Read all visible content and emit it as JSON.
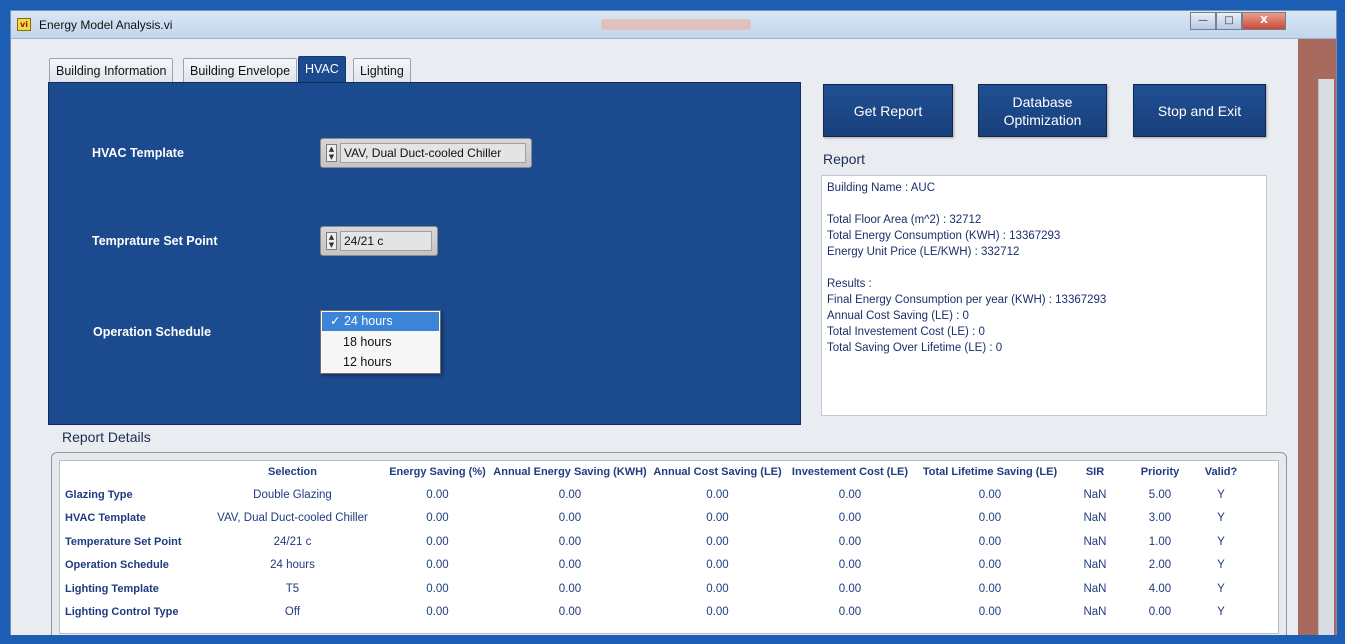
{
  "window": {
    "title": "Energy Model Analysis.vi",
    "app_icon_text": "vi",
    "minimize_glyph": "—",
    "maximize_glyph": "□",
    "close_glyph": "X"
  },
  "tabs": [
    {
      "label": "Building Information"
    },
    {
      "label": "Building Envelope"
    },
    {
      "label": "HVAC"
    },
    {
      "label": "Lighting"
    }
  ],
  "hvac": {
    "template_label": "HVAC Template",
    "template_value": "VAV, Dual Duct-cooled Chiller",
    "setpoint_label": "Temprature Set Point",
    "setpoint_value": "24/21 c",
    "schedule_label": "Operation Schedule",
    "schedule_options": [
      "✓ 24 hours",
      "18 hours",
      "12 hours"
    ]
  },
  "buttons": {
    "get_report": "Get Report",
    "database_optimization_line1": "Database",
    "database_optimization_line2": "Optimization",
    "stop_exit": "Stop and Exit"
  },
  "report": {
    "label": "Report",
    "lines": [
      "Building Name : AUC",
      "",
      "Total Floor Area  (m^2) : 32712",
      "Total Energy Consumption  (KWH) : 13367293",
      "Energy Unit Price  (LE/KWH) : 332712",
      "",
      "Results :",
      "Final Energy Consumption per year  (KWH) :  13367293",
      "Annual Cost Saving (LE) : 0",
      "Total Investement Cost  (LE) : 0",
      "Total Saving Over Lifetime (LE) : 0"
    ]
  },
  "details": {
    "label": "Report Details",
    "headers": [
      "",
      "Selection",
      "Energy Saving (%)",
      "Annual Energy Saving (KWH)",
      "Annual Cost Saving (LE)",
      "Investement Cost (LE)",
      "Total Lifetime Saving (LE)",
      "SIR",
      "Priority",
      "Valid?"
    ],
    "rows": [
      [
        "Glazing Type",
        "Double Glazing",
        "0.00",
        "0.00",
        "0.00",
        "0.00",
        "0.00",
        "NaN",
        "5.00",
        "Y"
      ],
      [
        "HVAC Template",
        "VAV, Dual Duct-cooled Chiller",
        "0.00",
        "0.00",
        "0.00",
        "0.00",
        "0.00",
        "NaN",
        "3.00",
        "Y"
      ],
      [
        "Temperature Set Point",
        "24/21 c",
        "0.00",
        "0.00",
        "0.00",
        "0.00",
        "0.00",
        "NaN",
        "1.00",
        "Y"
      ],
      [
        "Operation Schedule",
        "24 hours",
        "0.00",
        "0.00",
        "0.00",
        "0.00",
        "0.00",
        "NaN",
        "2.00",
        "Y"
      ],
      [
        "Lighting Template",
        "T5",
        "0.00",
        "0.00",
        "0.00",
        "0.00",
        "0.00",
        "NaN",
        "4.00",
        "Y"
      ],
      [
        "Lighting Control Type",
        "Off",
        "0.00",
        "0.00",
        "0.00",
        "0.00",
        "0.00",
        "NaN",
        "0.00",
        "Y"
      ]
    ]
  },
  "colors": {
    "panel_blue": "#1c4a8e",
    "frame_blue": "#1d5eb5",
    "table_text": "#1f3c80"
  }
}
